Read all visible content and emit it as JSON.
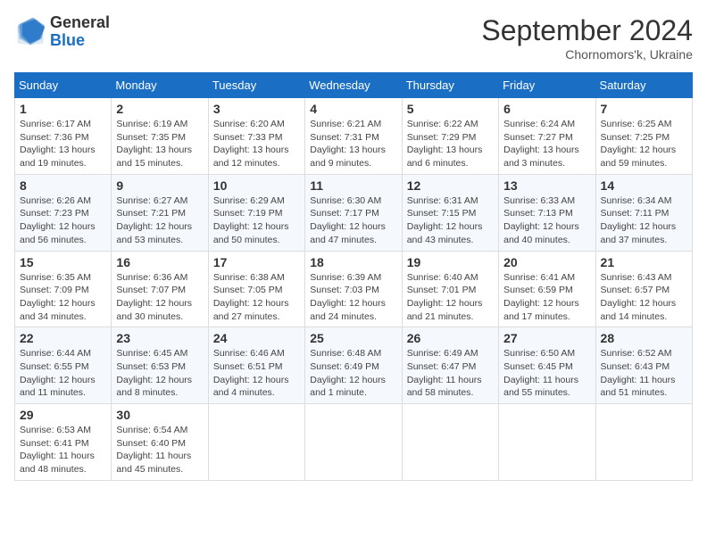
{
  "logo": {
    "general": "General",
    "blue": "Blue"
  },
  "header": {
    "month": "September 2024",
    "location": "Chornomors'k, Ukraine"
  },
  "weekdays": [
    "Sunday",
    "Monday",
    "Tuesday",
    "Wednesday",
    "Thursday",
    "Friday",
    "Saturday"
  ],
  "weeks": [
    [
      {
        "day": "1",
        "sunrise": "Sunrise: 6:17 AM",
        "sunset": "Sunset: 7:36 PM",
        "daylight": "Daylight: 13 hours and 19 minutes."
      },
      {
        "day": "2",
        "sunrise": "Sunrise: 6:19 AM",
        "sunset": "Sunset: 7:35 PM",
        "daylight": "Daylight: 13 hours and 15 minutes."
      },
      {
        "day": "3",
        "sunrise": "Sunrise: 6:20 AM",
        "sunset": "Sunset: 7:33 PM",
        "daylight": "Daylight: 13 hours and 12 minutes."
      },
      {
        "day": "4",
        "sunrise": "Sunrise: 6:21 AM",
        "sunset": "Sunset: 7:31 PM",
        "daylight": "Daylight: 13 hours and 9 minutes."
      },
      {
        "day": "5",
        "sunrise": "Sunrise: 6:22 AM",
        "sunset": "Sunset: 7:29 PM",
        "daylight": "Daylight: 13 hours and 6 minutes."
      },
      {
        "day": "6",
        "sunrise": "Sunrise: 6:24 AM",
        "sunset": "Sunset: 7:27 PM",
        "daylight": "Daylight: 13 hours and 3 minutes."
      },
      {
        "day": "7",
        "sunrise": "Sunrise: 6:25 AM",
        "sunset": "Sunset: 7:25 PM",
        "daylight": "Daylight: 12 hours and 59 minutes."
      }
    ],
    [
      {
        "day": "8",
        "sunrise": "Sunrise: 6:26 AM",
        "sunset": "Sunset: 7:23 PM",
        "daylight": "Daylight: 12 hours and 56 minutes."
      },
      {
        "day": "9",
        "sunrise": "Sunrise: 6:27 AM",
        "sunset": "Sunset: 7:21 PM",
        "daylight": "Daylight: 12 hours and 53 minutes."
      },
      {
        "day": "10",
        "sunrise": "Sunrise: 6:29 AM",
        "sunset": "Sunset: 7:19 PM",
        "daylight": "Daylight: 12 hours and 50 minutes."
      },
      {
        "day": "11",
        "sunrise": "Sunrise: 6:30 AM",
        "sunset": "Sunset: 7:17 PM",
        "daylight": "Daylight: 12 hours and 47 minutes."
      },
      {
        "day": "12",
        "sunrise": "Sunrise: 6:31 AM",
        "sunset": "Sunset: 7:15 PM",
        "daylight": "Daylight: 12 hours and 43 minutes."
      },
      {
        "day": "13",
        "sunrise": "Sunrise: 6:33 AM",
        "sunset": "Sunset: 7:13 PM",
        "daylight": "Daylight: 12 hours and 40 minutes."
      },
      {
        "day": "14",
        "sunrise": "Sunrise: 6:34 AM",
        "sunset": "Sunset: 7:11 PM",
        "daylight": "Daylight: 12 hours and 37 minutes."
      }
    ],
    [
      {
        "day": "15",
        "sunrise": "Sunrise: 6:35 AM",
        "sunset": "Sunset: 7:09 PM",
        "daylight": "Daylight: 12 hours and 34 minutes."
      },
      {
        "day": "16",
        "sunrise": "Sunrise: 6:36 AM",
        "sunset": "Sunset: 7:07 PM",
        "daylight": "Daylight: 12 hours and 30 minutes."
      },
      {
        "day": "17",
        "sunrise": "Sunrise: 6:38 AM",
        "sunset": "Sunset: 7:05 PM",
        "daylight": "Daylight: 12 hours and 27 minutes."
      },
      {
        "day": "18",
        "sunrise": "Sunrise: 6:39 AM",
        "sunset": "Sunset: 7:03 PM",
        "daylight": "Daylight: 12 hours and 24 minutes."
      },
      {
        "day": "19",
        "sunrise": "Sunrise: 6:40 AM",
        "sunset": "Sunset: 7:01 PM",
        "daylight": "Daylight: 12 hours and 21 minutes."
      },
      {
        "day": "20",
        "sunrise": "Sunrise: 6:41 AM",
        "sunset": "Sunset: 6:59 PM",
        "daylight": "Daylight: 12 hours and 17 minutes."
      },
      {
        "day": "21",
        "sunrise": "Sunrise: 6:43 AM",
        "sunset": "Sunset: 6:57 PM",
        "daylight": "Daylight: 12 hours and 14 minutes."
      }
    ],
    [
      {
        "day": "22",
        "sunrise": "Sunrise: 6:44 AM",
        "sunset": "Sunset: 6:55 PM",
        "daylight": "Daylight: 12 hours and 11 minutes."
      },
      {
        "day": "23",
        "sunrise": "Sunrise: 6:45 AM",
        "sunset": "Sunset: 6:53 PM",
        "daylight": "Daylight: 12 hours and 8 minutes."
      },
      {
        "day": "24",
        "sunrise": "Sunrise: 6:46 AM",
        "sunset": "Sunset: 6:51 PM",
        "daylight": "Daylight: 12 hours and 4 minutes."
      },
      {
        "day": "25",
        "sunrise": "Sunrise: 6:48 AM",
        "sunset": "Sunset: 6:49 PM",
        "daylight": "Daylight: 12 hours and 1 minute."
      },
      {
        "day": "26",
        "sunrise": "Sunrise: 6:49 AM",
        "sunset": "Sunset: 6:47 PM",
        "daylight": "Daylight: 11 hours and 58 minutes."
      },
      {
        "day": "27",
        "sunrise": "Sunrise: 6:50 AM",
        "sunset": "Sunset: 6:45 PM",
        "daylight": "Daylight: 11 hours and 55 minutes."
      },
      {
        "day": "28",
        "sunrise": "Sunrise: 6:52 AM",
        "sunset": "Sunset: 6:43 PM",
        "daylight": "Daylight: 11 hours and 51 minutes."
      }
    ],
    [
      {
        "day": "29",
        "sunrise": "Sunrise: 6:53 AM",
        "sunset": "Sunset: 6:41 PM",
        "daylight": "Daylight: 11 hours and 48 minutes."
      },
      {
        "day": "30",
        "sunrise": "Sunrise: 6:54 AM",
        "sunset": "Sunset: 6:40 PM",
        "daylight": "Daylight: 11 hours and 45 minutes."
      },
      null,
      null,
      null,
      null,
      null
    ]
  ]
}
